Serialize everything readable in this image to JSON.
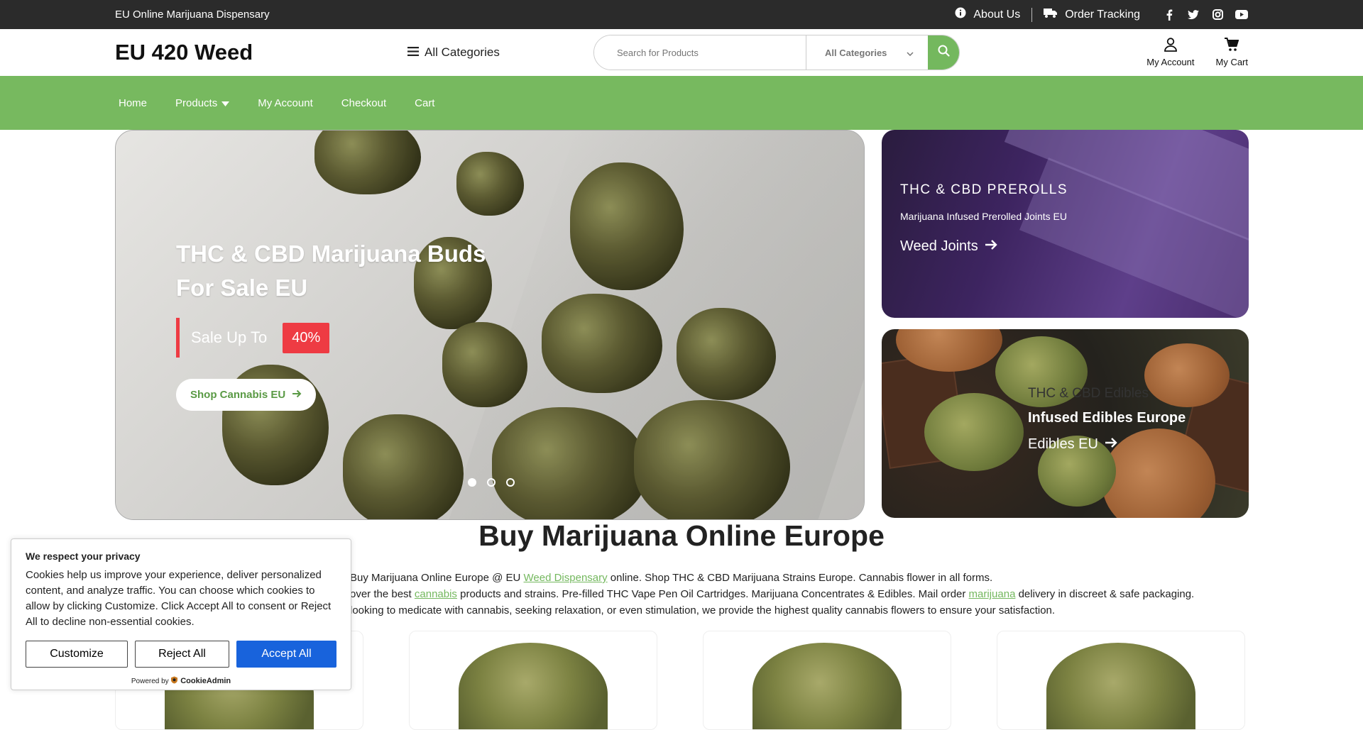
{
  "topbar": {
    "tagline": "EU Online Marijuana Dispensary",
    "about": "About Us",
    "tracking": "Order Tracking",
    "social": [
      "facebook-icon",
      "twitter-icon",
      "instagram-icon",
      "youtube-icon"
    ]
  },
  "header": {
    "logo": "EU 420 Weed",
    "all_categories": "All Categories",
    "search_placeholder": "Search for Products",
    "search_category": "All Categories",
    "account": "My Account",
    "cart": "My Cart"
  },
  "nav": {
    "items": [
      "Home",
      "Products",
      "My Account",
      "Checkout",
      "Cart"
    ]
  },
  "hero": {
    "title": "THC & CBD Marijuana Buds For Sale EU",
    "sale_text": "Sale Up To",
    "sale_badge": "40%",
    "button": "Shop Cannabis EU",
    "slides": 3,
    "active_slide": 1
  },
  "promo1": {
    "title": "THC & CBD PREROLLS",
    "subtitle": "Marijuana Infused Prerolled Joints EU",
    "link": "Weed Joints"
  },
  "promo2": {
    "title": "THC & CBD Edibles",
    "subtitle": "Infused Edibles Europe",
    "link": "Edibles EU"
  },
  "main": {
    "heading": "Buy Marijuana Online Europe",
    "intro_line1_a": "Buy Marijuana Online Europe @ EU ",
    "intro_link1": "Weed Dispensary",
    "intro_line1_b": " online. Shop THC & CBD Marijuana Strains Europe. Cannabis flower in all forms.",
    "intro_line2_a": "over the best ",
    "intro_link2": "cannabis",
    "intro_line2_b": " products and strains. Pre-filled THC Vape Pen Oil Cartridges. Marijuana Concentrates & Edibles. Mail order ",
    "intro_link3": "marijuana",
    "intro_line2_c": " delivery in discreet & safe packaging.",
    "intro_line3": "looking to medicate with cannabis, seeking relaxation, or even stimulation, we provide the highest quality cannabis flowers to ensure your satisfaction."
  },
  "cookie": {
    "title": "We respect your privacy",
    "text_a": "Cookies help us improve your experience, deliver personalized content, and analyze traffic. You can choose which cookies to allow by clicking ",
    "text_customize": "Customize",
    "text_b": ". Click ",
    "text_accept": "Accept All",
    "text_c": " to consent or ",
    "text_reject": "Reject All",
    "text_d": " to decline non-essential cookies.",
    "btn_customize": "Customize",
    "btn_reject": "Reject All",
    "btn_accept": "Accept All",
    "powered": "Powered by",
    "brand": "CookieAdmin"
  },
  "colors": {
    "accent": "#77b95f",
    "topbar": "#2b2b2b",
    "sale": "#ee3b43",
    "cookie_primary": "#1863dc"
  }
}
